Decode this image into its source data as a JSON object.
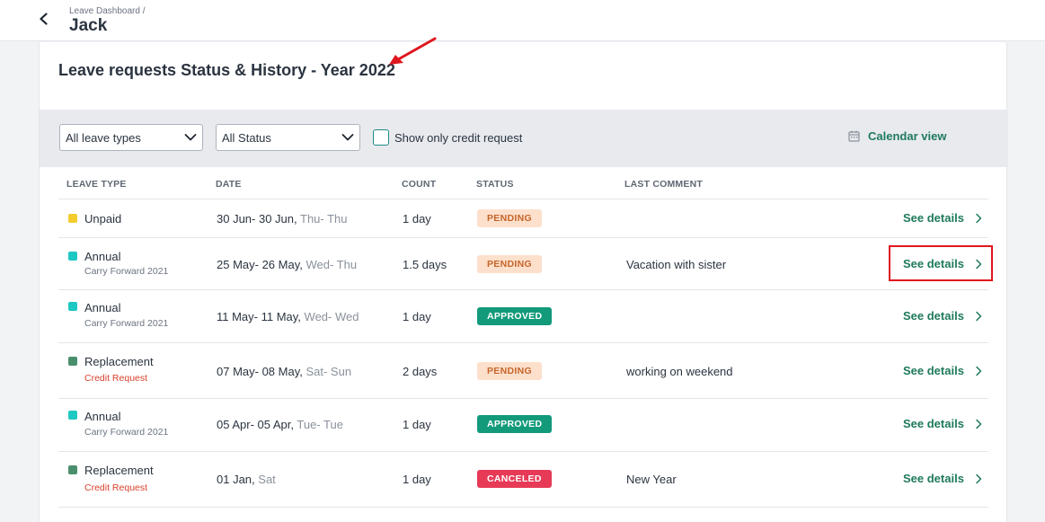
{
  "header": {
    "breadcrumb": "Leave Dashboard /",
    "title": "Jack"
  },
  "card": {
    "title": "Leave requests Status & History - Year 2022"
  },
  "filters": {
    "leave_type": "All leave types",
    "status": "All Status",
    "credit_checkbox_label": "Show only credit request",
    "calendar_view": "Calendar view"
  },
  "table": {
    "headers": [
      "LEAVE TYPE",
      "DATE",
      "COUNT",
      "STATUS",
      "LAST COMMENT"
    ],
    "rows": [
      {
        "type": "Unpaid",
        "color": "#f2cd2d",
        "sub": "",
        "date": "30 Jun- 30 Jun,",
        "days": " Thu- Thu",
        "count": "1 day",
        "status": "PENDING",
        "comment": "",
        "action": "See details"
      },
      {
        "type": "Annual",
        "color": "#1ec8c2",
        "sub": "Carry Forward 2021",
        "date": "25 May- 26 May,",
        "days": " Wed- Thu",
        "count": "1.5 days",
        "status": "PENDING",
        "comment": "Vacation with sister",
        "action": "See details"
      },
      {
        "type": "Annual",
        "color": "#1ec8c2",
        "sub": "Carry Forward 2021",
        "date": "11 May- 11 May,",
        "days": " Wed- Wed",
        "count": "1 day",
        "status": "APPROVED",
        "comment": "",
        "action": "See details"
      },
      {
        "type": "Replacement",
        "color": "#4a8f6d",
        "sub": "Credit Request",
        "date": "07 May- 08 May,",
        "days": " Sat- Sun",
        "count": "2 days",
        "status": "PENDING",
        "comment": "working on weekend",
        "action": "See details"
      },
      {
        "type": "Annual",
        "color": "#1ec8c2",
        "sub": "Carry Forward 2021",
        "date": "05 Apr- 05 Apr,",
        "days": " Tue- Tue",
        "count": "1 day",
        "status": "APPROVED",
        "comment": "",
        "action": "See details"
      },
      {
        "type": "Replacement",
        "color": "#4a8f6d",
        "sub": "Credit Request",
        "date": "01 Jan,",
        "days": " Sat",
        "count": "1 day",
        "status": "CANCELED",
        "comment": "New Year",
        "action": "See details"
      }
    ]
  },
  "colors": {
    "accent": "#1f7a5c",
    "credit_request": "#d9412c",
    "carry_forward": "#6b7380",
    "annotation": "#e0161e"
  }
}
